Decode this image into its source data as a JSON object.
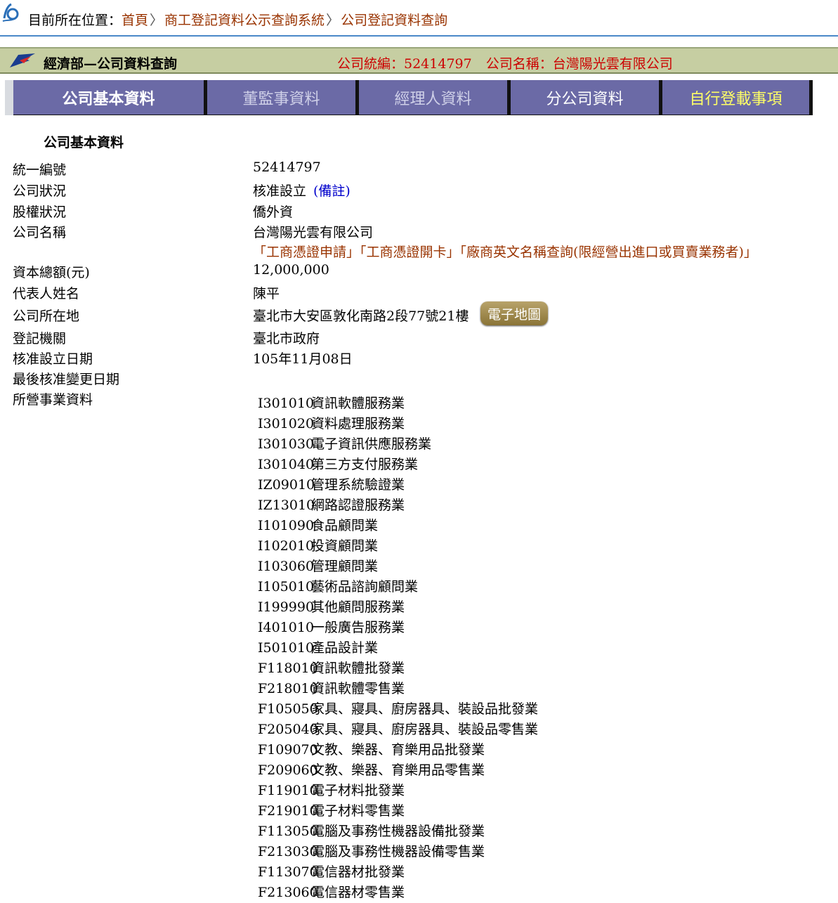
{
  "breadcrumb": {
    "prefix": "目前所在位置：",
    "items": [
      "首頁",
      "商工登記資料公示查詢系統",
      "公司登記資料查詢"
    ],
    "separator": "〉"
  },
  "header": {
    "title": "經濟部—公司資料查詢",
    "company_id_label": "公司統編：52414797",
    "company_name_label": "公司名稱：台灣陽光雲有限公司"
  },
  "tabs": [
    {
      "label": "公司基本資料"
    },
    {
      "label": "董監事資料"
    },
    {
      "label": "經理人資料"
    },
    {
      "label": "分公司資料"
    },
    {
      "label": "自行登載事項"
    }
  ],
  "section_title": "公司基本資料",
  "fields": {
    "uid": {
      "label": "統一編號",
      "value": "52414797"
    },
    "status": {
      "label": "公司狀況",
      "value": "核准設立",
      "note": "(備註)"
    },
    "equity": {
      "label": "股權狀況",
      "value": "僑外資"
    },
    "name": {
      "label": "公司名稱",
      "value": "台灣陽光雲有限公司"
    },
    "name_links": [
      "「工商憑證申請」",
      "「工商憑證開卡」",
      "「廠商英文名稱查詢(限經營出進口或買賣業務者)」"
    ],
    "capital": {
      "label": "資本總額(元)",
      "value": "12,000,000"
    },
    "rep": {
      "label": "代表人姓名",
      "value": "陳平"
    },
    "address": {
      "label": "公司所在地",
      "value": "臺北市大安區敦化南路2段77號21樓",
      "map_button": "電子地圖"
    },
    "authority": {
      "label": "登記機關",
      "value": "臺北市政府"
    },
    "approve_date": {
      "label": "核准設立日期",
      "value": "105年11月08日"
    },
    "last_change": {
      "label": "最後核准變更日期",
      "value": ""
    },
    "business": {
      "label": "所營事業資料"
    }
  },
  "business_items": [
    {
      "code": "I301010",
      "desc": "資訊軟體服務業"
    },
    {
      "code": "I301020",
      "desc": "資料處理服務業"
    },
    {
      "code": "I301030",
      "desc": "電子資訊供應服務業"
    },
    {
      "code": "I301040",
      "desc": "第三方支付服務業"
    },
    {
      "code": "IZ09010",
      "desc": "管理系統驗證業"
    },
    {
      "code": "IZ13010",
      "desc": "網路認證服務業"
    },
    {
      "code": "I101090",
      "desc": "食品顧問業"
    },
    {
      "code": "I102010",
      "desc": "投資顧問業"
    },
    {
      "code": "I103060",
      "desc": "管理顧問業"
    },
    {
      "code": "I105010",
      "desc": "藝術品諮詢顧問業"
    },
    {
      "code": "I199990",
      "desc": "其他顧問服務業"
    },
    {
      "code": "I401010",
      "desc": "一般廣告服務業"
    },
    {
      "code": "I501010",
      "desc": "產品設計業"
    },
    {
      "code": "F118010",
      "desc": "資訊軟體批發業"
    },
    {
      "code": "F218010",
      "desc": "資訊軟體零售業"
    },
    {
      "code": "F105050",
      "desc": "家具、寢具、廚房器具、裝設品批發業"
    },
    {
      "code": "F205040",
      "desc": "家具、寢具、廚房器具、裝設品零售業"
    },
    {
      "code": "F109070",
      "desc": "文教、樂器、育樂用品批發業"
    },
    {
      "code": "F209060",
      "desc": "文教、樂器、育樂用品零售業"
    },
    {
      "code": "F119010",
      "desc": "電子材料批發業"
    },
    {
      "code": "F219010",
      "desc": "電子材料零售業"
    },
    {
      "code": "F113050",
      "desc": "電腦及事務性機器設備批發業"
    },
    {
      "code": "F213030",
      "desc": "電腦及事務性機器設備零售業"
    },
    {
      "code": "F113070",
      "desc": "電信器材批發業"
    },
    {
      "code": "F213060",
      "desc": "電信器材零售業"
    }
  ]
}
